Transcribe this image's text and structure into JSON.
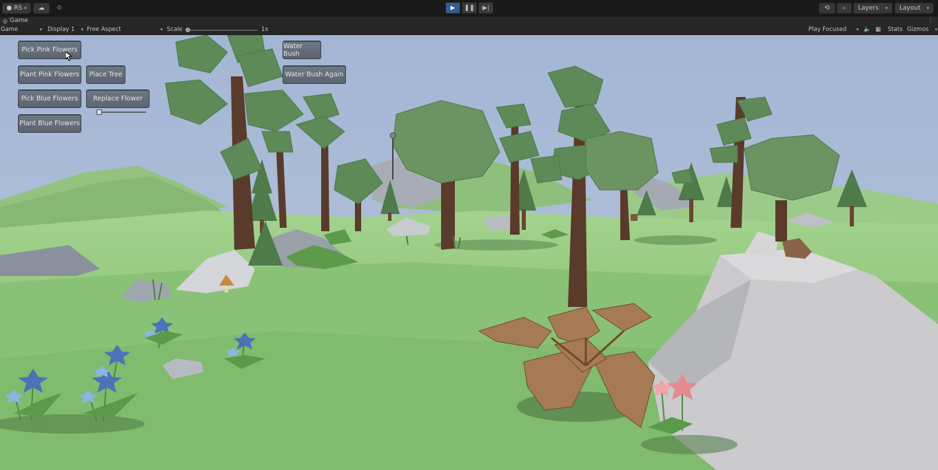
{
  "toolbar": {
    "account": "RS",
    "layers": "Layers",
    "layout": "Layout"
  },
  "tab": {
    "title": "Game"
  },
  "game_toolbar": {
    "mode": "Game",
    "display": "Display 1",
    "aspect": "Free Aspect",
    "scale_label": "Scale",
    "scale_value": "1x",
    "play_focused": "Play Focused",
    "stats": "Stats",
    "gizmos": "Gizmos"
  },
  "gui": {
    "pick_pink": "Pick Pink Flowers",
    "plant_pink": "Plant Pink Flowers",
    "place_tree": "Place Tree",
    "pick_blue": "Pick Blue Flowers",
    "replace_flower": "Replace Flower",
    "plant_blue": "Plant Blue Flowers",
    "water_bush": "Water Bush",
    "water_bush_again": "Water Bush Again"
  },
  "colors": {
    "sky": "#a6b9d6",
    "grass": "#8fc47a",
    "foliage": "#5f8a58",
    "trunk": "#5a3a2a",
    "rock": "#c7c7c9",
    "gui_button": "#646d78"
  }
}
